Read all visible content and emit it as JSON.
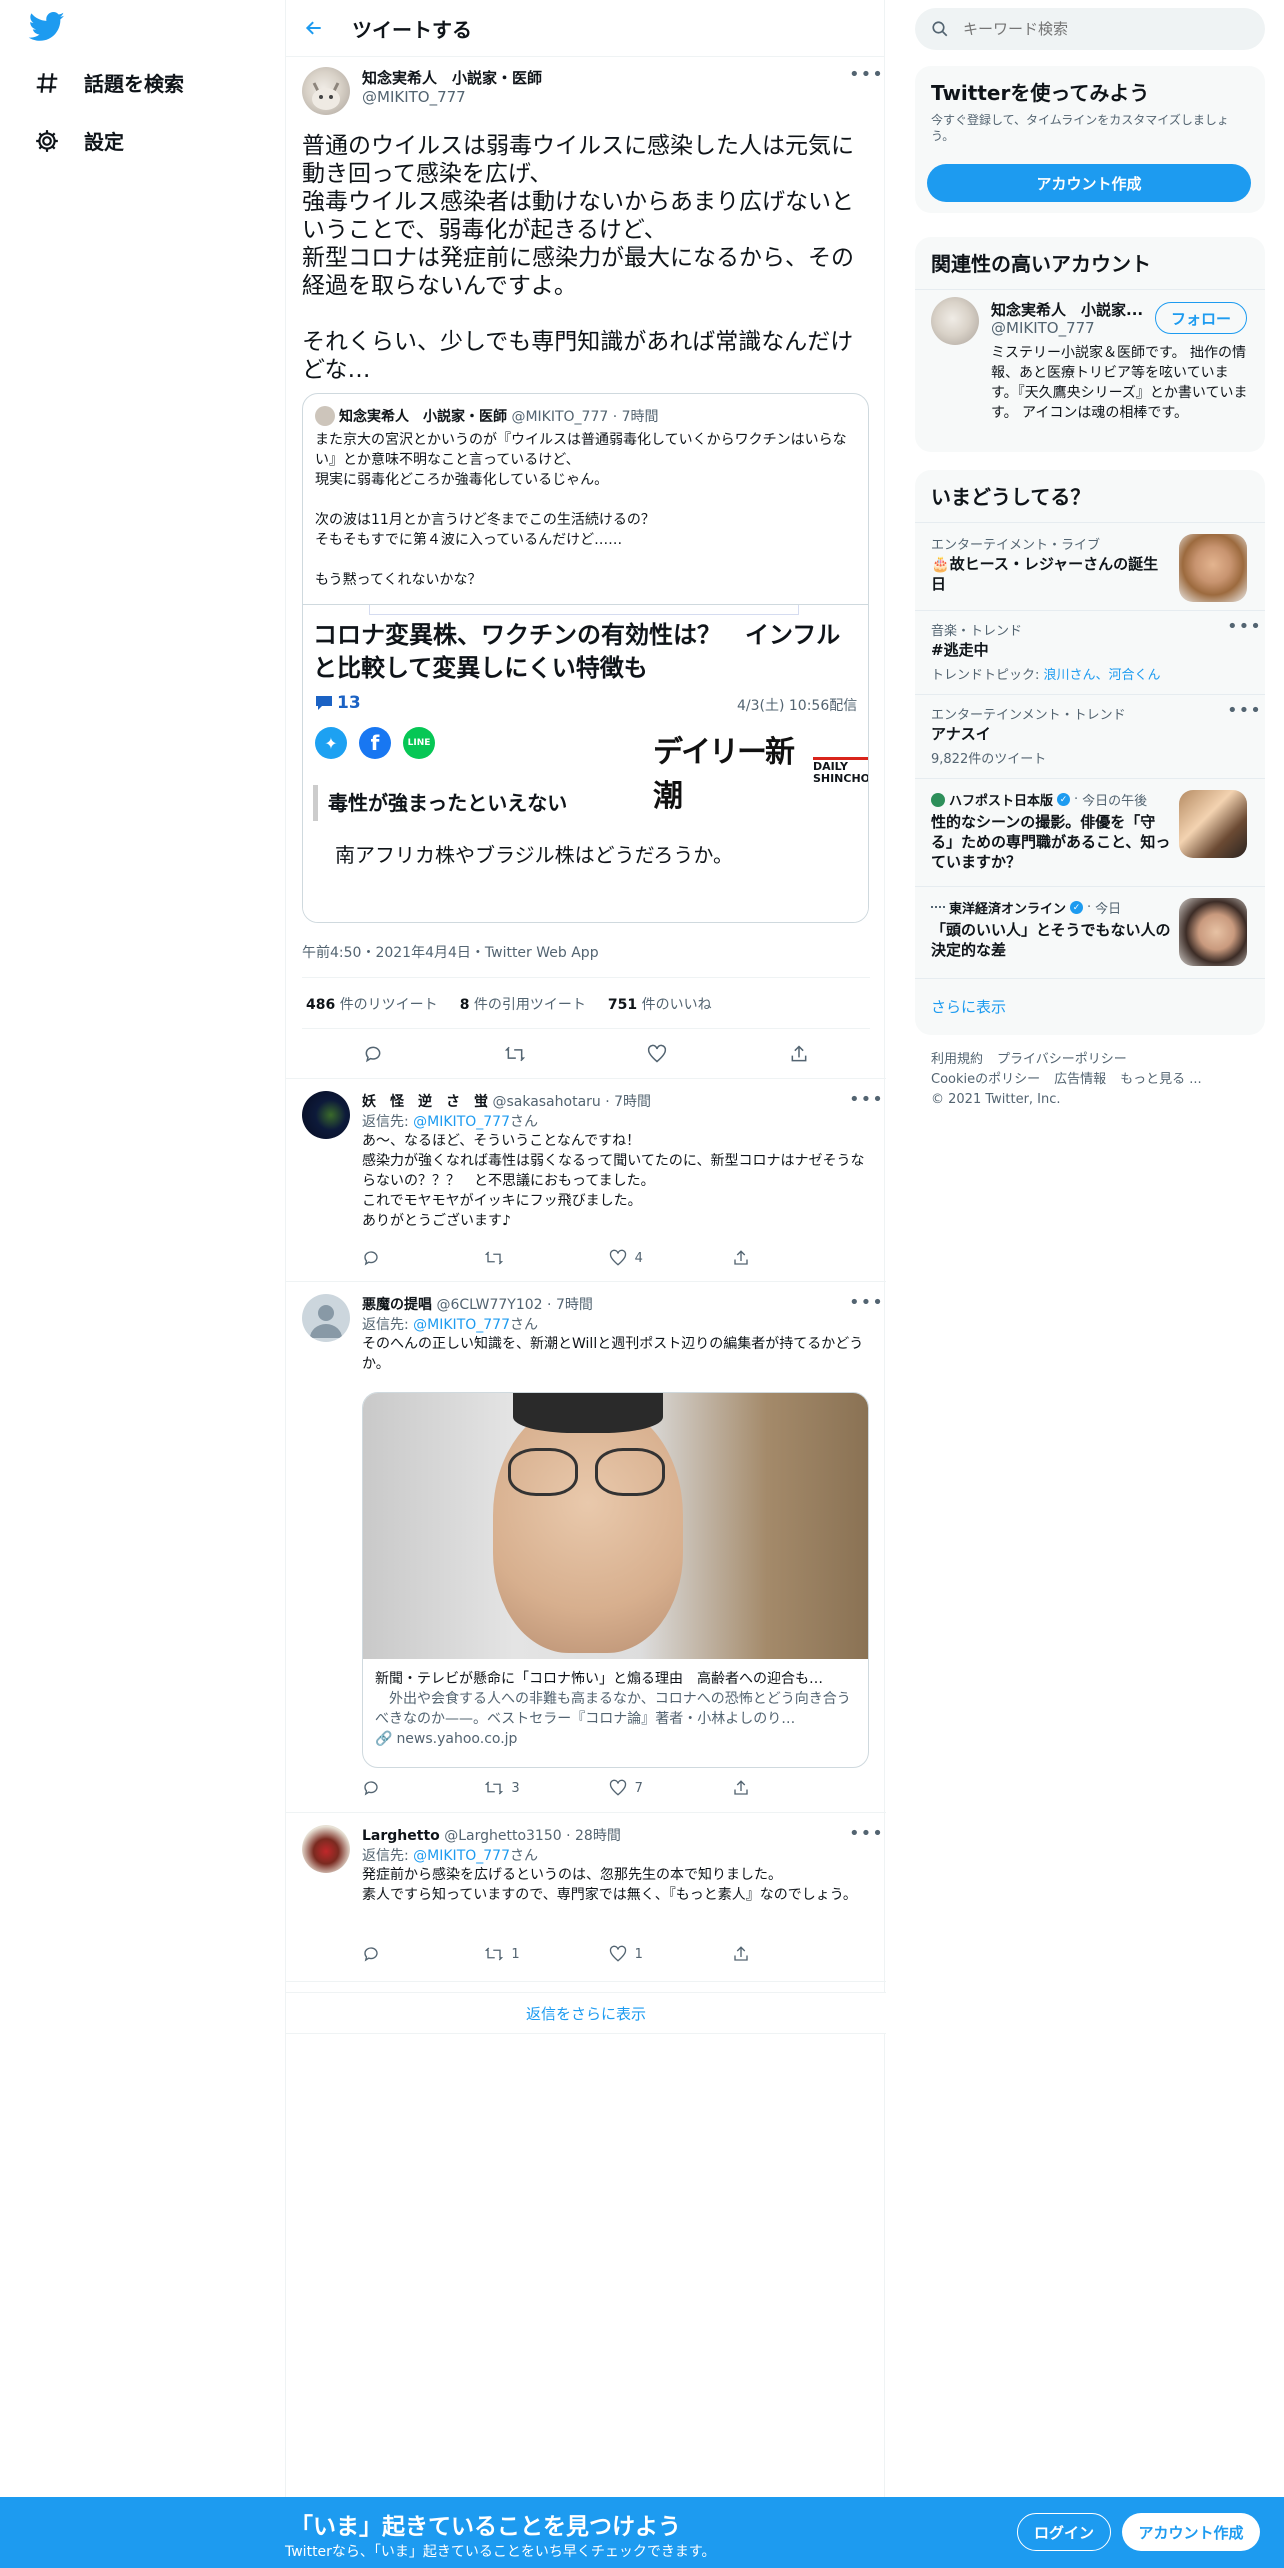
{
  "nav": {
    "explore": "話題を検索",
    "settings": "設定"
  },
  "header": {
    "title": "ツイートする"
  },
  "tweet": {
    "name": "知念実希人　小説家・医師",
    "handle": "@MIKITO_777",
    "text": "普通のウイルスは弱毒ウイルスに感染した人は元気に動き回って感染を広げ、\n強毒ウイルス感染者は動けないからあまり広げないということで、弱毒化が起きるけど、\n新型コロナは発症前に感染力が最大になるから、その経過を取らないんですよ。\n\nそれくらい、少しでも専門知識があれば常識なんだけどな…",
    "meta": "午前4:50・2021年4月4日・Twitter Web App",
    "retweets": "486",
    "retweets_label": "件のリツイート",
    "quotes": "8",
    "quotes_label": "件の引用ツイート",
    "likes": "751",
    "likes_label": "件のいいね"
  },
  "quoted": {
    "name": "知念実希人　小説家・医師",
    "handle": "@MIKITO_777",
    "time": "7時間",
    "text": "また京大の宮沢とかいうのが『ウイルスは普通弱毒化していくからワクチンはいらない』とか意味不明なこと言っているけど、\n現実に弱毒化どころか強毒化しているじゃん。\n\n次の波は11月とか言うけど冬までこの生活続けるの？\nそもそもすでに第４波に入っているんだけど……\n\nもう黙ってくれないかな？",
    "headline": "コロナ変異株、ワクチンの有効性は？　インフルと比較して変異しにくい特徴も",
    "comments": "13",
    "date": "4/3(土) 10:56配信",
    "logo_main": "デイリー新潮",
    "logo_sub1": "DAILY",
    "logo_sub2": "SHINCHO",
    "subhead": "毒性が強まったといえない",
    "body": "南アフリカ株やブラジル株はどうだろうか。"
  },
  "replies": [
    {
      "name": "妖　怪　逆　さ　蛍",
      "handle": "@sakasahotaru",
      "time": "7時間",
      "replying": "返信先:",
      "to": "@MIKITO_777",
      "san": "さん",
      "text": "あ〜、なるほど、そういうことなんですね！\n感染力が強くなれば毒性は弱くなるって聞いてたのに、新型コロナはナゼそうならないの？？？　と不思議におもってました。\nこれでモヤモヤがイッキにフッ飛びました。\nありがとうございます♪",
      "rt": "",
      "like": "4"
    },
    {
      "name": "悪魔の提唱",
      "handle": "@6CLW77Y102",
      "time": "7時間",
      "replying": "返信先:",
      "to": "@MIKITO_777",
      "san": "さん",
      "text": "そのへんの正しい知識を、新潮とWillと週刊ポスト辺りの編集者が持てるかどうか。",
      "rt": "3",
      "like": "7",
      "card_title": "新聞・テレビが懸命に「コロナ怖い」と煽る理由　高齢者への迎合も…",
      "card_desc": "外出や会食する人への非難も高まるなか、コロナへの恐怖とどう向き合うべきなのか——。ベストセラー『コロナ論』著者・小林よしのり…",
      "card_domain": "news.yahoo.co.jp"
    },
    {
      "name": "Larghetto",
      "handle": "@Larghetto3150",
      "time": "28時間",
      "replying": "返信先:",
      "to": "@MIKITO_777",
      "san": "さん",
      "text": "発症前から感染を広げるというのは、忽那先生の本で知りました。\n素人ですら知っていますので、専門家では無く、『もっと素人』なのでしょう。",
      "rt": "1",
      "like": "1"
    }
  ],
  "show_more": "返信をさらに表示",
  "right": {
    "search_placeholder": "キーワード検索",
    "signup": {
      "title": "Twitterを使ってみよう",
      "desc": "今すぐ登録して、タイムラインをカスタマイズしましょう。",
      "button": "アカウント作成"
    },
    "related": {
      "title": "関連性の高いアカウント",
      "name": "知念実希人　小説家...",
      "handle": "@MIKITO_777",
      "follow": "フォロー",
      "bio": "ミステリー小説家＆医師です。 拙作の情報、あと医療トリビア等を呟いています。『天久鷹央シリーズ』とか書いています。 アイコンは魂の相棒です。"
    },
    "trends": {
      "title": "いまどうしてる？",
      "items": [
        {
          "label": "エンターテイメント・ライブ",
          "title": "🎂故ヒース・レジャーさんの誕生日"
        },
        {
          "label": "音楽・トレンド",
          "title": "#逃走中",
          "sub_prefix": "トレンドトピック: ",
          "sub": "浪川さん、河合くん"
        },
        {
          "label": "エンターテインメント・トレンド",
          "title": "アナスイ",
          "sub": "9,822件のツイート"
        },
        {
          "source": "ハフポスト日本版",
          "time": "今日の午後",
          "title": "性的なシーンの撮影。俳優を「守る」ための専門職があること、知っていますか？"
        },
        {
          "source": "東洋経済オンライン",
          "time": "今日",
          "title": "「頭のいい人」とそうでもない人の決定的な差"
        }
      ],
      "more": "さらに表示"
    },
    "footer": {
      "l1": "利用規約",
      "l2": "プライバシーポリシー",
      "l3": "Cookieのポリシー",
      "l4": "広告情報",
      "l5": "もっと見る ...",
      "copy": "© 2021 Twitter, Inc."
    }
  },
  "bottom": {
    "title": "「いま」起きていることを見つけよう",
    "sub": "Twitterなら、「いま」起きていることをいち早くチェックできます。",
    "login": "ログイン",
    "signup": "アカウント作成"
  }
}
